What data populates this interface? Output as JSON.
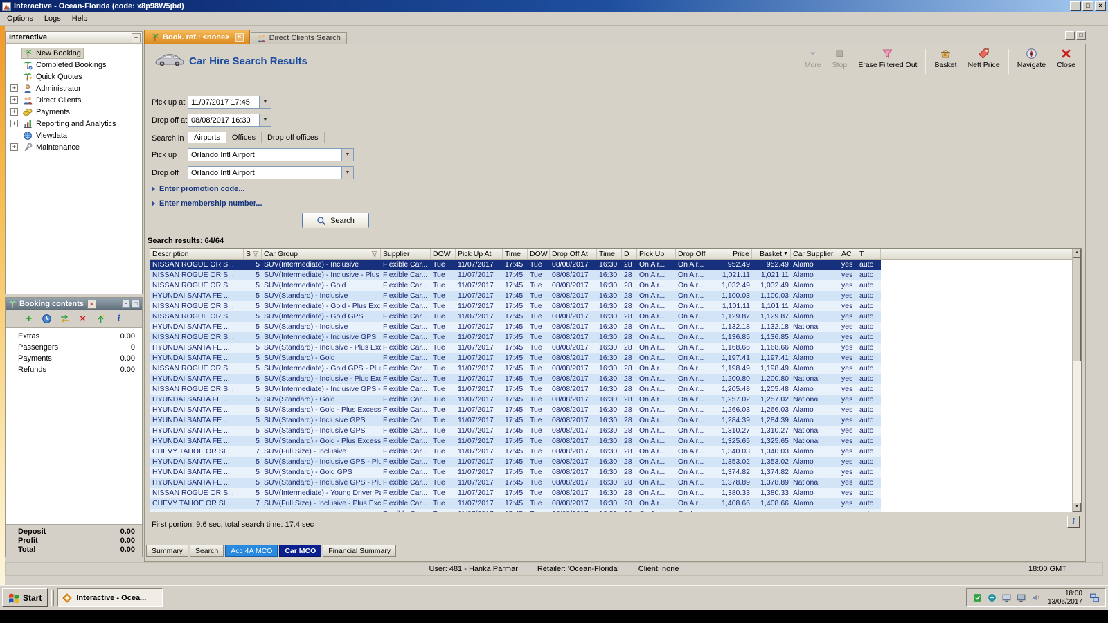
{
  "window": {
    "title": "Interactive - Ocean-Florida (code: x8p98W5jbd)",
    "menu": [
      "Options",
      "Logs",
      "Help"
    ]
  },
  "sidebar": {
    "title": "Interactive",
    "items": [
      {
        "label": "New Booking",
        "icon": "palm",
        "expandable": false,
        "selected": true
      },
      {
        "label": "Completed Bookings",
        "icon": "palm-check",
        "expandable": false
      },
      {
        "label": "Quick Quotes",
        "icon": "palm-quick",
        "expandable": false
      },
      {
        "label": "Administrator",
        "icon": "person",
        "expandable": true
      },
      {
        "label": "Direct Clients",
        "icon": "people",
        "expandable": true
      },
      {
        "label": "Payments",
        "icon": "money",
        "expandable": true
      },
      {
        "label": "Reporting and Analytics",
        "icon": "chart",
        "expandable": true
      },
      {
        "label": "Viewdata",
        "icon": "globe",
        "expandable": false
      },
      {
        "label": "Maintenance",
        "icon": "tools",
        "expandable": true
      }
    ]
  },
  "booking_contents": {
    "title": "Booking contents",
    "toolbar_icons": [
      "add",
      "world-clock",
      "transfer",
      "delete",
      "upload",
      "info"
    ],
    "rows": [
      {
        "label": "Extras",
        "value": "0.00"
      },
      {
        "label": "Passengers",
        "value": "0"
      },
      {
        "label": "Payments",
        "value": "0.00"
      },
      {
        "label": "Refunds",
        "value": "0.00"
      }
    ],
    "totals": [
      {
        "label": "Deposit",
        "value": "0.00"
      },
      {
        "label": "Profit",
        "value": "0.00"
      },
      {
        "label": "Total",
        "value": "0.00"
      }
    ]
  },
  "doc_tabs": [
    {
      "label": "Book. ref.: <none>",
      "icon": "palm",
      "active": true,
      "closable": true
    },
    {
      "label": "Direct Clients Search",
      "icon": "people",
      "active": false
    }
  ],
  "main": {
    "title": "Car Hire Search Results",
    "toolbar": [
      {
        "label": "More",
        "icon": "more-arrow",
        "enabled": false
      },
      {
        "label": "Stop",
        "icon": "stop",
        "enabled": false
      },
      {
        "label": "Erase Filtered Out",
        "icon": "erase-filter",
        "enabled": true
      },
      {
        "label": "Basket",
        "icon": "basket",
        "enabled": true,
        "sep_before": true
      },
      {
        "label": "Nett Price",
        "icon": "price-tag",
        "enabled": true
      },
      {
        "label": "Navigate",
        "icon": "compass",
        "enabled": true,
        "sep_before": true
      },
      {
        "label": "Close",
        "icon": "close-red",
        "enabled": true
      }
    ],
    "form": {
      "pickup_at_label": "Pick up at",
      "pickup_at_value": "11/07/2017 17:45",
      "dropoff_at_label": "Drop off at",
      "dropoff_at_value": "08/08/2017 16:30",
      "search_in_label": "Search in",
      "search_in_options": [
        "Airports",
        "Offices",
        "Drop off offices"
      ],
      "search_in_selected": "Airports",
      "pickup_label": "Pick up",
      "pickup_value": "Orlando Intl Airport",
      "dropoff_label": "Drop off",
      "dropoff_value": "Orlando Intl Airport",
      "promotion_expander": "Enter promotion code...",
      "membership_expander": "Enter membership number...",
      "search_button": "Search"
    },
    "results_label": "Search results: 64/64",
    "table": {
      "columns": [
        "Description",
        "S",
        "Car Group",
        "Supplier",
        "DOW",
        "Pick Up At",
        "Time",
        "DOW",
        "Drop Off At",
        "Time",
        "D",
        "Pick Up",
        "Drop Off",
        "Price",
        "Basket",
        "Car Supplier",
        "AC",
        "T"
      ],
      "common": {
        "supplier": "Flexible Car...",
        "dow_pickup": "Tue",
        "pickup_date": "11/07/2017",
        "pickup_time": "17:45",
        "dow_dropoff": "Tue",
        "dropoff_date": "08/08/2017",
        "dropoff_time": "16:30",
        "days": "28",
        "pickup_location": "On Air...",
        "dropoff_location": "On Air...",
        "ac": "yes",
        "transmission": "auto"
      },
      "rows": [
        {
          "description": "NISSAN ROGUE OR S...",
          "s": "5",
          "car_group": "SUV(Intermediate) - Inclusive",
          "price": "952.49",
          "basket": "952.49",
          "car_supplier": "Alamo",
          "selected": true
        },
        {
          "description": "NISSAN ROGUE OR S...",
          "s": "5",
          "car_group": "SUV(Intermediate) - Inclusive - Plus E...",
          "price": "1,021.11",
          "basket": "1,021.11",
          "car_supplier": "Alamo"
        },
        {
          "description": "NISSAN ROGUE OR S...",
          "s": "5",
          "car_group": "SUV(Intermediate) - Gold",
          "price": "1,032.49",
          "basket": "1,032.49",
          "car_supplier": "Alamo"
        },
        {
          "description": "HYUNDAI SANTA FE ...",
          "s": "5",
          "car_group": "SUV(Standard) - Inclusive",
          "price": "1,100.03",
          "basket": "1,100.03",
          "car_supplier": "Alamo"
        },
        {
          "description": "NISSAN ROGUE OR S...",
          "s": "5",
          "car_group": "SUV(Intermediate) - Gold - Plus Exces...",
          "price": "1,101.11",
          "basket": "1,101.11",
          "car_supplier": "Alamo"
        },
        {
          "description": "NISSAN ROGUE OR S...",
          "s": "5",
          "car_group": "SUV(Intermediate) - Gold GPS",
          "price": "1,129.87",
          "basket": "1,129.87",
          "car_supplier": "Alamo"
        },
        {
          "description": "HYUNDAI SANTA FE ...",
          "s": "5",
          "car_group": "SUV(Standard) - Inclusive",
          "price": "1,132.18",
          "basket": "1,132.18",
          "car_supplier": "National"
        },
        {
          "description": "NISSAN ROGUE OR S...",
          "s": "5",
          "car_group": "SUV(Intermediate) - Inclusive GPS",
          "price": "1,136.85",
          "basket": "1,136.85",
          "car_supplier": "Alamo"
        },
        {
          "description": "HYUNDAI SANTA FE ...",
          "s": "5",
          "car_group": "SUV(Standard) - Inclusive - Plus Exce...",
          "price": "1,168.66",
          "basket": "1,168.66",
          "car_supplier": "Alamo"
        },
        {
          "description": "HYUNDAI SANTA FE ...",
          "s": "5",
          "car_group": "SUV(Standard) - Gold",
          "price": "1,197.41",
          "basket": "1,197.41",
          "car_supplier": "Alamo"
        },
        {
          "description": "NISSAN ROGUE OR S...",
          "s": "5",
          "car_group": "SUV(Intermediate) - Gold GPS - Plus E...",
          "price": "1,198.49",
          "basket": "1,198.49",
          "car_supplier": "Alamo"
        },
        {
          "description": "HYUNDAI SANTA FE ...",
          "s": "5",
          "car_group": "SUV(Standard) - Inclusive - Plus Exce...",
          "price": "1,200.80",
          "basket": "1,200.80",
          "car_supplier": "National"
        },
        {
          "description": "NISSAN ROGUE OR S...",
          "s": "5",
          "car_group": "SUV(Intermediate) - Inclusive GPS - Pl...",
          "price": "1,205.48",
          "basket": "1,205.48",
          "car_supplier": "Alamo"
        },
        {
          "description": "HYUNDAI SANTA FE ...",
          "s": "5",
          "car_group": "SUV(Standard) - Gold",
          "price": "1,257.02",
          "basket": "1,257.02",
          "car_supplier": "National"
        },
        {
          "description": "HYUNDAI SANTA FE ...",
          "s": "5",
          "car_group": "SUV(Standard) - Gold - Plus Excess R...",
          "price": "1,266.03",
          "basket": "1,266.03",
          "car_supplier": "Alamo"
        },
        {
          "description": "HYUNDAI SANTA FE ...",
          "s": "5",
          "car_group": "SUV(Standard) - Inclusive GPS",
          "price": "1,284.39",
          "basket": "1,284.39",
          "car_supplier": "Alamo"
        },
        {
          "description": "HYUNDAI SANTA FE ...",
          "s": "5",
          "car_group": "SUV(Standard) - Inclusive GPS",
          "price": "1,310.27",
          "basket": "1,310.27",
          "car_supplier": "National"
        },
        {
          "description": "HYUNDAI SANTA FE ...",
          "s": "5",
          "car_group": "SUV(Standard) - Gold - Plus Excess R...",
          "price": "1,325.65",
          "basket": "1,325.65",
          "car_supplier": "National"
        },
        {
          "description": "CHEVY TAHOE OR SI...",
          "s": "7",
          "car_group": "SUV(Full Size) - Inclusive",
          "price": "1,340.03",
          "basket": "1,340.03",
          "car_supplier": "Alamo"
        },
        {
          "description": "HYUNDAI SANTA FE ...",
          "s": "5",
          "car_group": "SUV(Standard) - Inclusive GPS - Plus ...",
          "price": "1,353.02",
          "basket": "1,353.02",
          "car_supplier": "Alamo"
        },
        {
          "description": "HYUNDAI SANTA FE ...",
          "s": "5",
          "car_group": "SUV(Standard) - Gold GPS",
          "price": "1,374.82",
          "basket": "1,374.82",
          "car_supplier": "Alamo"
        },
        {
          "description": "HYUNDAI SANTA FE ...",
          "s": "5",
          "car_group": "SUV(Standard) - Inclusive GPS - Plus ...",
          "price": "1,378.89",
          "basket": "1,378.89",
          "car_supplier": "National"
        },
        {
          "description": "NISSAN ROGUE OR S...",
          "s": "5",
          "car_group": "SUV(Intermediate) - Young Driver Pac...",
          "price": "1,380.33",
          "basket": "1,380.33",
          "car_supplier": "Alamo"
        },
        {
          "description": "CHEVY TAHOE OR SI...",
          "s": "7",
          "car_group": "SUV(Full Size) - Inclusive - Plus Excess...",
          "price": "1,408.66",
          "basket": "1,408.66",
          "car_supplier": "Alamo"
        },
        {
          "description": "",
          "s": "",
          "car_group": "",
          "price": "",
          "basket": "",
          "car_supplier": ""
        }
      ]
    },
    "status_line": "First portion: 9.6 sec, total search time: 17.4 sec",
    "bottom_tabs": [
      {
        "label": "Summary"
      },
      {
        "label": "Search"
      },
      {
        "label": "Acc 4A MCO",
        "color": "blue"
      },
      {
        "label": "Car MCO",
        "color": "navy"
      },
      {
        "label": "Financial Summary"
      }
    ]
  },
  "status_bar": {
    "user": "User: 481 - Harika Parmar",
    "retailer": "Retailer: 'Ocean-Florida'",
    "client": "Client: none",
    "time": "18:00 GMT"
  },
  "taskbar": {
    "start_label": "Start",
    "task_label": "Interactive - Ocea...",
    "clock_time": "18:00",
    "clock_date": "13/06/2017"
  },
  "colors": {
    "selection_row": "#16307e",
    "acc_tab_blue": "#2a8ae0",
    "car_tab_navy": "#0a2090",
    "active_tab_orange": "#e89030",
    "title_bar": "#0a246a"
  }
}
